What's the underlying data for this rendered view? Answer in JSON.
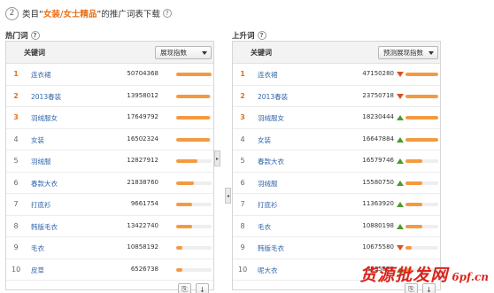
{
  "header": {
    "step": "2",
    "prefix": "类目“",
    "category": "女装/女士精品",
    "suffix": "”的推广词表下载"
  },
  "left": {
    "section_label": "热门词",
    "col_keyword": "关键词",
    "dropdown": "展现指数",
    "rows": [
      {
        "rank": "1",
        "keyword": "连衣裙",
        "value": "50704368",
        "pct": 1.0
      },
      {
        "rank": "2",
        "keyword": "2013春装",
        "value": "13958012",
        "pct": 0.95
      },
      {
        "rank": "3",
        "keyword": "羽绒服女",
        "value": "17649792",
        "pct": 0.95
      },
      {
        "rank": "4",
        "keyword": "女装",
        "value": "16502324",
        "pct": 0.95
      },
      {
        "rank": "5",
        "keyword": "羽绒服",
        "value": "12827912",
        "pct": 0.6
      },
      {
        "rank": "6",
        "keyword": "春款大衣",
        "value": "21838760",
        "pct": 0.5
      },
      {
        "rank": "7",
        "keyword": "打底衫",
        "value": "9661754",
        "pct": 0.45
      },
      {
        "rank": "8",
        "keyword": "韩版毛衣",
        "value": "13422740",
        "pct": 0.45
      },
      {
        "rank": "9",
        "keyword": "毛衣",
        "value": "10858192",
        "pct": 0.18
      },
      {
        "rank": "10",
        "keyword": "皮草",
        "value": "6526738",
        "pct": 0.18
      }
    ]
  },
  "right": {
    "section_label": "上升词",
    "col_keyword": "关键词",
    "dropdown": "预测展现指数",
    "rows": [
      {
        "rank": "1",
        "keyword": "连衣裙",
        "value": "47150280",
        "trend": "down",
        "pct": 1.0
      },
      {
        "rank": "2",
        "keyword": "2013春装",
        "value": "23750718",
        "trend": "down",
        "pct": 1.0
      },
      {
        "rank": "3",
        "keyword": "羽绒服女",
        "value": "18230444",
        "trend": "up",
        "pct": 1.0
      },
      {
        "rank": "4",
        "keyword": "女装",
        "value": "16647884",
        "trend": "up",
        "pct": 1.0
      },
      {
        "rank": "5",
        "keyword": "春款大衣",
        "value": "16579746",
        "trend": "up",
        "pct": 0.5
      },
      {
        "rank": "6",
        "keyword": "羽绒服",
        "value": "15580750",
        "trend": "up",
        "pct": 0.5
      },
      {
        "rank": "7",
        "keyword": "打底衫",
        "value": "11363920",
        "trend": "up",
        "pct": 0.5
      },
      {
        "rank": "8",
        "keyword": "毛衣",
        "value": "10880198",
        "trend": "up",
        "pct": 0.5
      },
      {
        "rank": "9",
        "keyword": "韩版毛衣",
        "value": "10675580",
        "trend": "down",
        "pct": 0.2
      },
      {
        "rank": "10",
        "keyword": "呢大衣",
        "value": "8995828",
        "trend": "up",
        "pct": 0.2
      }
    ]
  },
  "footer": {
    "copy_icon": "copy-icon",
    "download_icon": "download-icon"
  },
  "watermark": {
    "main": "货源批发网",
    "sub": "6pf.cn"
  },
  "colors": {
    "accent": "#e8711a",
    "bar": "#f39a41",
    "up": "#4e9a2a",
    "down": "#d9531e",
    "link": "#3366aa"
  }
}
